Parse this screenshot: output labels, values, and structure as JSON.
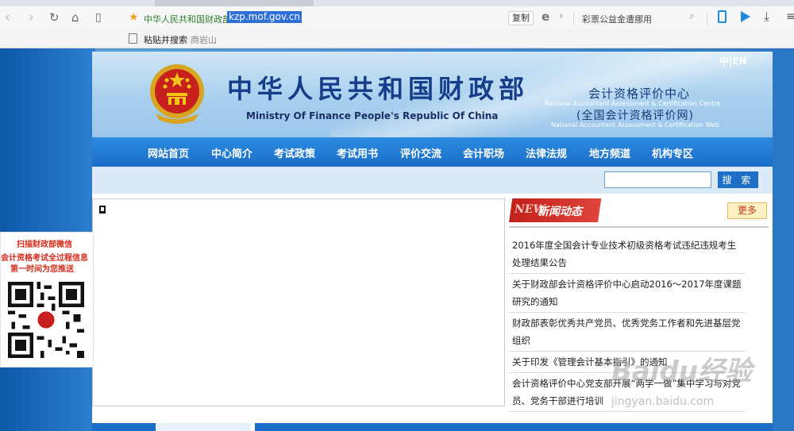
{
  "browser": {
    "site_title": "中华人民共和国财政部",
    "url": "kzp.mof.gov.cn",
    "copy_label": "复制",
    "search_hint": "彩票公益金遭挪用",
    "bookmarks": {
      "paste_search": "粘贴并搜索",
      "query_text": "商岩山"
    }
  },
  "header": {
    "title_cn": "中华人民共和国财政部",
    "title_en": "Ministry Of Finance People's Republic Of China",
    "lang_switch": "中|EN",
    "center_cn": "会计资格评价中心",
    "center_en": "National Accountant Assessment & Certification Centre",
    "center_net": "(全国会计资格评价网)",
    "center_net_en": "National Accountant Assessment & Certification Web"
  },
  "nav": [
    "网站首页",
    "中心简介",
    "考试政策",
    "考试用书",
    "评价交流",
    "会计职场",
    "法律法规",
    "地方频道",
    "机构专区"
  ],
  "search": {
    "value": "",
    "button_label": "搜 索"
  },
  "news": {
    "tag": "NEW",
    "title": "新闻动态",
    "more_label": "更多",
    "items": [
      "2016年度全国会计专业技术初级资格考试违纪违规考生处理结果公告",
      "关于财政部会计资格评价中心启动2016～2017年度课题研究的通知",
      "财政部表彰优秀共产党员、优秀党务工作者和先进基层党组织",
      "关于印发《管理会计基本指引》的通知",
      "会计资格评价中心党支部开展“两学一做”集中学习与对党员、党务干部进行培训"
    ]
  },
  "wechat": {
    "line1": "扫描财政部微信",
    "line2": "会计资格考试全过程信息",
    "line3": "第一时间为您推送"
  },
  "watermark": {
    "main": "Baidu经验",
    "sub": "jingyan.baidu.com"
  },
  "colors": {
    "nav_blue": "#1a6ec7",
    "title_blue": "#153d8a",
    "news_red": "#c0211a",
    "wechat_red": "#d62c1a"
  }
}
